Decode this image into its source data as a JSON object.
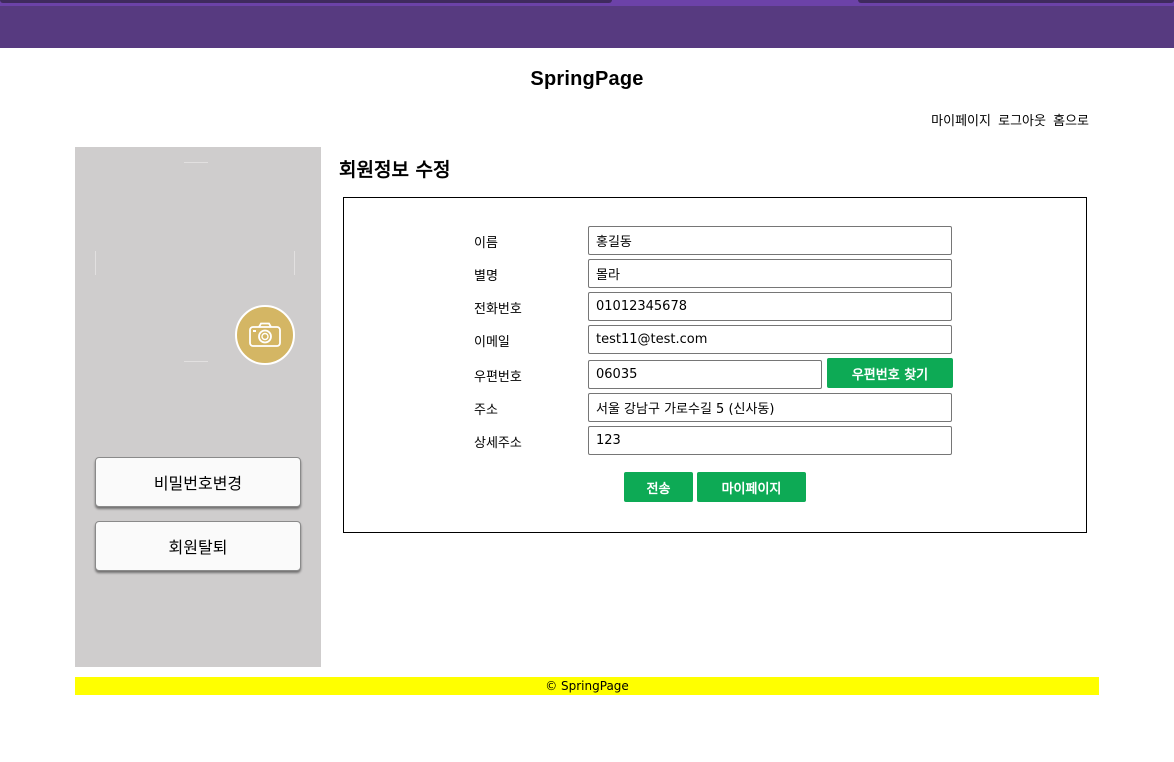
{
  "colors": {
    "top_bar": "#573a80",
    "sidebar_bg": "#cfcdcd",
    "camera_button": "#d4b664",
    "accent_green": "#0daa55",
    "footer_bg": "#ffff00"
  },
  "header": {
    "site_title": "SpringPage",
    "nav": [
      "마이페이지",
      "로그아웃",
      "홈으로"
    ]
  },
  "sidebar": {
    "camera_icon": "camera-icon",
    "buttons": [
      "비밀번호변경",
      "회원탈퇴"
    ]
  },
  "main": {
    "heading": "회원정보 수정",
    "fields": [
      {
        "label": "이름",
        "value": "홍길동"
      },
      {
        "label": "별명",
        "value": "몰라"
      },
      {
        "label": "전화번호",
        "value": "01012345678"
      },
      {
        "label": "이메일",
        "value": "test11@test.com"
      },
      {
        "label": "우편번호",
        "value": "06035"
      },
      {
        "label": "주소",
        "value": "서울 강남구 가로수길 5 (신사동)"
      },
      {
        "label": "상세주소",
        "value": "123"
      }
    ],
    "find_postcode_button": "우편번호 찾기",
    "submit_button": "전송",
    "mypage_button": "마이페이지"
  },
  "footer": {
    "text": "© SpringPage"
  }
}
